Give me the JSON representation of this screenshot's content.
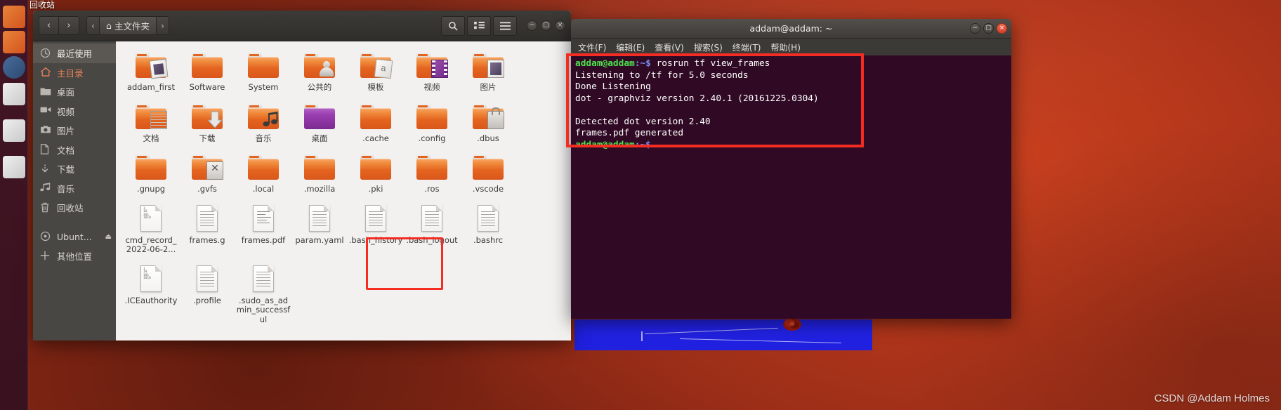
{
  "desktop": {
    "top_label": "回收站",
    "watermark": "CSDN @Addam Holmes"
  },
  "launcher": {
    "items": [
      {
        "name": "launcher-item-1"
      },
      {
        "name": "launcher-item-2"
      },
      {
        "name": "launcher-item-3"
      },
      {
        "name": "launcher-item-4"
      },
      {
        "name": "launcher-item-5"
      },
      {
        "name": "launcher-item-6"
      }
    ]
  },
  "file_manager": {
    "nav": {
      "back": "‹",
      "forward": "›",
      "prev_crumb": "‹",
      "next_crumb": "›"
    },
    "breadcrumb": {
      "home_icon": "⌂",
      "current": "主文件夹"
    },
    "toolbar": {
      "search": "search-icon",
      "view_grid": "grid-view-icon",
      "menu": "hamburger-menu-icon"
    },
    "window_controls": {
      "minimize": "−",
      "maximize": "□",
      "close": "×"
    },
    "sidebar": [
      {
        "label": "最近使用",
        "icon": "clock-icon",
        "selected": true
      },
      {
        "label": "主目录",
        "icon": "home-icon",
        "selected": false
      },
      {
        "label": "桌面",
        "icon": "folder-icon",
        "selected": false
      },
      {
        "label": "视频",
        "icon": "video-icon",
        "selected": false
      },
      {
        "label": "图片",
        "icon": "camera-icon",
        "selected": false
      },
      {
        "label": "文档",
        "icon": "document-icon",
        "selected": false
      },
      {
        "label": "下载",
        "icon": "download-icon",
        "selected": false
      },
      {
        "label": "音乐",
        "icon": "music-icon",
        "selected": false
      },
      {
        "label": "回收站",
        "icon": "trash-icon",
        "selected": false
      },
      {
        "label": "Ubunt...",
        "icon": "disc-icon",
        "selected": false,
        "eject": "⏏"
      },
      {
        "label": "其他位置",
        "icon": "plus-icon",
        "selected": false
      }
    ],
    "files": [
      {
        "label": "addam_first",
        "type": "folder",
        "overlay": "photo"
      },
      {
        "label": "Software",
        "type": "folder",
        "overlay": "none"
      },
      {
        "label": "System",
        "type": "folder",
        "overlay": "none"
      },
      {
        "label": "公共的",
        "type": "folder",
        "overlay": "person"
      },
      {
        "label": "模板",
        "type": "folder",
        "overlay": "template"
      },
      {
        "label": "视频",
        "type": "folder",
        "overlay": "film"
      },
      {
        "label": "图片",
        "type": "folder",
        "overlay": "picture"
      },
      {
        "label": "文档",
        "type": "folder",
        "overlay": "document"
      },
      {
        "label": "下载",
        "type": "folder",
        "overlay": "download"
      },
      {
        "label": "音乐",
        "type": "folder",
        "overlay": "music"
      },
      {
        "label": "桌面",
        "type": "folder-purple",
        "overlay": "desktop"
      },
      {
        "label": ".cache",
        "type": "folder",
        "overlay": "none"
      },
      {
        "label": ".config",
        "type": "folder",
        "overlay": "none"
      },
      {
        "label": ".dbus",
        "type": "folder",
        "overlay": "lock"
      },
      {
        "label": ".gnupg",
        "type": "folder",
        "overlay": "none"
      },
      {
        "label": ".gvfs",
        "type": "folder",
        "overlay": "x"
      },
      {
        "label": ".local",
        "type": "folder",
        "overlay": "none"
      },
      {
        "label": ".mozilla",
        "type": "folder",
        "overlay": "none"
      },
      {
        "label": ".pki",
        "type": "folder",
        "overlay": "none"
      },
      {
        "label": ".ros",
        "type": "folder",
        "overlay": "none"
      },
      {
        "label": ".vscode",
        "type": "folder",
        "overlay": "none"
      },
      {
        "label": "cmd_record_2022-06-2...",
        "type": "file-binary",
        "overlay": "none"
      },
      {
        "label": "frames.g",
        "type": "file-text",
        "overlay": "none"
      },
      {
        "label": "frames.pdf",
        "type": "file-pdf",
        "overlay": "none",
        "selected": true
      },
      {
        "label": "param.yaml",
        "type": "file-text",
        "overlay": "none"
      },
      {
        "label": ".bash_history",
        "type": "file-text",
        "overlay": "none"
      },
      {
        "label": ".bash_logout",
        "type": "file-text",
        "overlay": "none"
      },
      {
        "label": ".bashrc",
        "type": "file-text",
        "overlay": "none"
      },
      {
        "label": ".ICEauthority",
        "type": "file-binary",
        "overlay": "none"
      },
      {
        "label": ".profile",
        "type": "file-text",
        "overlay": "none"
      },
      {
        "label": ".sudo_as_admin_successful",
        "type": "file-text",
        "overlay": "none"
      }
    ]
  },
  "terminal": {
    "title": "addam@addam: ~",
    "window_controls": {
      "minimize": "−",
      "maximize": "□",
      "close": "×"
    },
    "menus": [
      "文件(F)",
      "编辑(E)",
      "查看(V)",
      "搜索(S)",
      "终端(T)",
      "帮助(H)"
    ],
    "lines": [
      {
        "prompt": "addam@addam",
        "path": ":~$",
        "text": " rosrun tf view_frames"
      },
      {
        "text": "Listening to /tf for 5.0 seconds"
      },
      {
        "text": "Done Listening"
      },
      {
        "text": "dot - graphviz version 2.40.1 (20161225.0304)"
      },
      {
        "text": ""
      },
      {
        "text": "Detected dot version 2.40"
      },
      {
        "text": "frames.pdf generated"
      },
      {
        "prompt": "addam@addam",
        "path": ":~$",
        "text": ""
      }
    ]
  },
  "colors": {
    "selection_red": "#f42c22",
    "terminal_bg": "#300a24",
    "prompt_green": "#4ee24e",
    "prompt_blue": "#7a8ff5",
    "desktop_orange": "#c34222",
    "folder_orange": "#e4641f"
  }
}
